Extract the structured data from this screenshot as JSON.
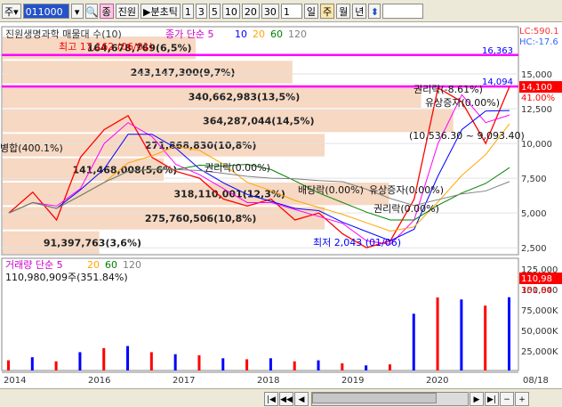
{
  "toolbar": {
    "market": "주",
    "code": "011000",
    "pink_label": "종",
    "name": "진원",
    "chart_type": "분초틱",
    "intervals": [
      "1",
      "3",
      "5",
      "10",
      "20",
      "30"
    ],
    "count": "1",
    "periods": [
      "일",
      "주",
      "월",
      "년"
    ],
    "selected_period": "주"
  },
  "price_panel": {
    "title": "진원생명과학 매물대 수(10)",
    "ma_prefix": "종가 단순 5",
    "ma_periods": [
      "10",
      "20",
      "60",
      "120"
    ],
    "lc_label": "LC:590.1",
    "hc_label": "HC:-17.6",
    "high_label": "최고 17,162 (06/01)",
    "low_label": "최저 2,043 (01/06)",
    "line1_value": "16,363",
    "line2_value": "14,094",
    "current_price": "14,100",
    "current_pct": "41.00%",
    "axis_ticks": [
      "15,000",
      "12,500",
      "10,000",
      "7,500",
      "5,000",
      "2,500"
    ],
    "colors": {
      "line1": "#ff00ff",
      "line2": "#ff00ff",
      "up": "#ff0000",
      "down": "#0000ff",
      "ma5": "#ff00ff",
      "ma10": "#0000ff",
      "ma20": "#ffa500",
      "ma60": "#008000",
      "ma120": "#808080",
      "volume_profile": "#f6d8c3"
    }
  },
  "volume_profile": [
    {
      "label": "91,397,763(3,6%)"
    },
    {
      "label": "275,760,506(10,8%)"
    },
    {
      "label": "318,110,001(12,3%)"
    },
    {
      "label": "141,468,008(5,6%)"
    },
    {
      "label": "271,868,830(10,8%)"
    },
    {
      "label": "364,287,044(14,5%)"
    },
    {
      "label": "340,662,983(13,5%)"
    },
    {
      "label": "243,147,300(9,7%)"
    },
    {
      "label": "164,678,769(6,5%)"
    }
  ],
  "annotations": [
    {
      "text": "병합(400.1%)"
    },
    {
      "text": "권리락(-8.61%)"
    },
    {
      "text": "유상증자(0.00%)"
    },
    {
      "text": "(10,536.30 ~ 9,093.40)"
    },
    {
      "text": "권리락(0.00%)"
    },
    {
      "text": "배당락(0.00%)"
    },
    {
      "text": "유상증자(0.00%)"
    },
    {
      "text": "권리락(0.00%)"
    }
  ],
  "volume_panel": {
    "title": "거래량 단순 5",
    "ma_periods": [
      "20",
      "60",
      "120"
    ],
    "value_label": "110,980,909주(351.84%)",
    "current_box": "110,98",
    "current_pct": "351.84",
    "axis_ticks": [
      "125,000",
      "100,000",
      "75,000K",
      "50,000K",
      "25,000K"
    ]
  },
  "x_axis": {
    "labels": [
      "2014",
      "2016",
      "2017",
      "2018",
      "2019",
      "2020"
    ],
    "right_label": "08/18"
  },
  "chart_data": {
    "type": "line",
    "series": [
      {
        "name": "price",
        "values": [
          5000,
          6500,
          4500,
          9000,
          11000,
          12000,
          9000,
          8000,
          7500,
          6000,
          5500,
          6000,
          4500,
          5000,
          3500,
          2500,
          3000,
          6000,
          14000,
          13000,
          10000,
          14100
        ]
      }
    ],
    "ylim": [
      2000,
      17500
    ]
  }
}
